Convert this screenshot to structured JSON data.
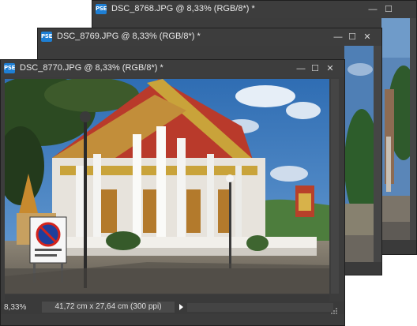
{
  "windows": [
    {
      "app_icon": "PSE",
      "title": "DSC_8768.JPG @ 8,33% (RGB/8*) *",
      "controls": {
        "minimize": "—",
        "maximize": "☐",
        "close": "✕"
      }
    },
    {
      "app_icon": "PSE",
      "title": "DSC_8769.JPG @ 8,33% (RGB/8*) *",
      "controls": {
        "minimize": "—",
        "maximize": "☐",
        "close": "✕"
      }
    },
    {
      "app_icon": "PSE",
      "title": "DSC_8770.JPG @ 8,33% (RGB/8*) *",
      "controls": {
        "minimize": "—",
        "maximize": "☐",
        "close": "✕"
      },
      "status": {
        "zoom": "8,33%",
        "document_size": "41,72 cm x 27,64 cm (300 ppi)"
      }
    }
  ],
  "icons": [
    "pse-app-icon",
    "minimize-icon",
    "maximize-icon",
    "close-icon",
    "status-menu-arrow-icon",
    "resize-grip-icon"
  ]
}
